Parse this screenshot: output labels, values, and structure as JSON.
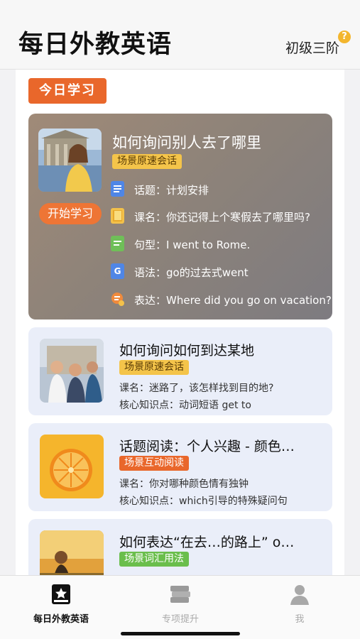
{
  "header": {
    "title": "每日外教英语",
    "level": "初级三阶",
    "help_icon": "?"
  },
  "today_badge": "今日学习",
  "featured": {
    "title": "如何询问别人去了哪里",
    "tag": "场景原速会话",
    "start_label": "开始学习",
    "rows": [
      {
        "icon": "topic-icon",
        "text": "话题：计划安排"
      },
      {
        "icon": "course-icon",
        "text": "课名：你还记得上个寒假去了哪里吗?"
      },
      {
        "icon": "pattern-icon",
        "text": "句型：I went to Rome."
      },
      {
        "icon": "grammar-icon",
        "glyph": "G",
        "text": "语法：go的过去式went"
      },
      {
        "icon": "expression-icon",
        "text": "表达：Where did you go on vacation?"
      }
    ]
  },
  "cards": [
    {
      "title": "如何询问如何到达某地",
      "tag": "场景原速会话",
      "tag_color": "yellow",
      "course": "课名：迷路了，该怎样找到目的地?",
      "knowledge": "核心知识点：动词短语 get to"
    },
    {
      "title": "话题阅读：个人兴趣 - 颜色…",
      "tag": "场景互动阅读",
      "tag_color": "orange",
      "course": "课名：你对哪种颜色情有独钟",
      "knowledge": "核心知识点：which引导的特殊疑问句"
    },
    {
      "title": "如何表达“在去…的路上” o…",
      "tag": "场景词汇用法",
      "tag_color": "green"
    }
  ],
  "tabbar": {
    "tabs": [
      {
        "label": "每日外教英语",
        "icon": "star-book-icon",
        "active": true
      },
      {
        "label": "专项提升",
        "icon": "books-stack-icon",
        "active": false
      },
      {
        "label": "我",
        "icon": "person-icon",
        "active": false
      }
    ]
  },
  "colors": {
    "accent_orange": "#e9672b",
    "tag_yellow": "#f4c44a",
    "tag_green": "#6abe4c",
    "card_bg": "#eaeef9"
  }
}
